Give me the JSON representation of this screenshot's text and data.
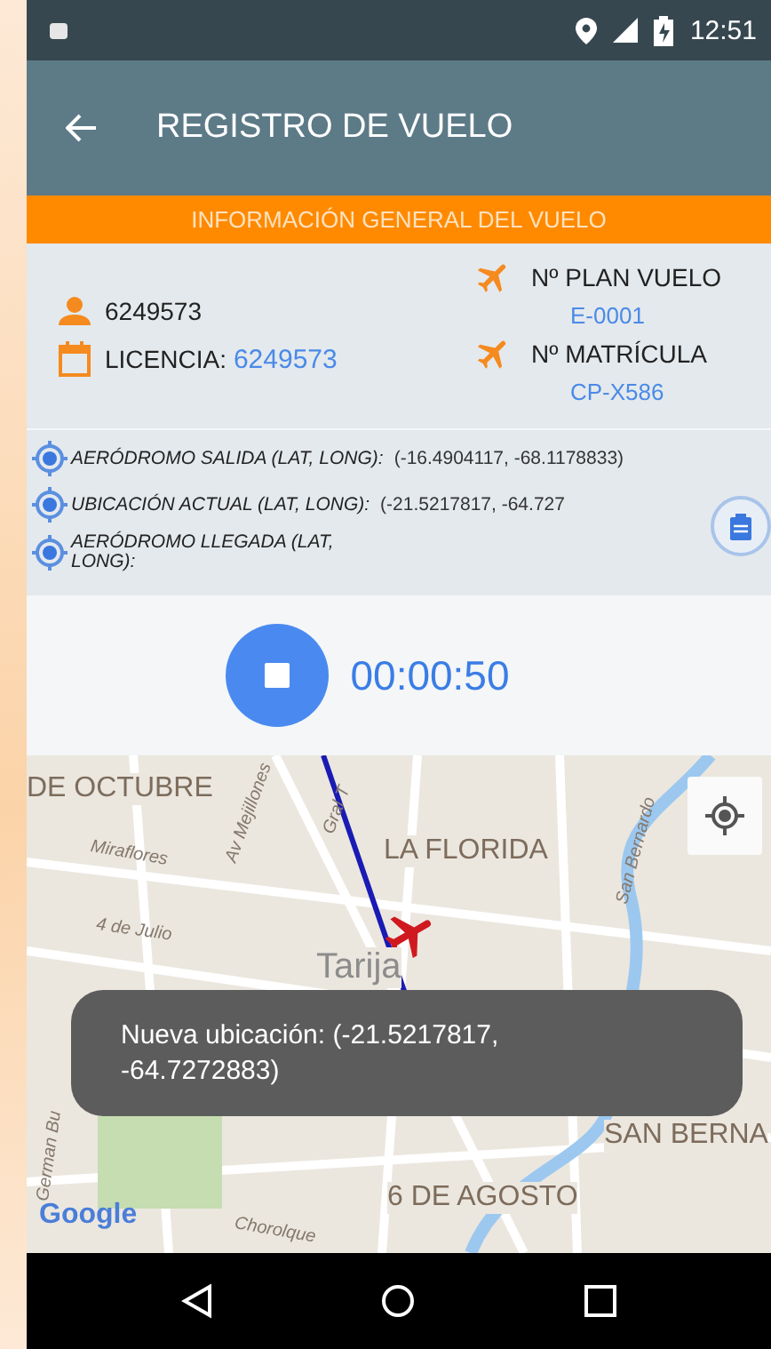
{
  "status_bar": {
    "time": "12:51"
  },
  "app_bar": {
    "title": "REGISTRO DE VUELO"
  },
  "banner": "INFORMACIÓN GENERAL DEL VUELO",
  "pilot": {
    "id": "6249573",
    "license_label": "LICENCIA:",
    "license": "6249573"
  },
  "flight": {
    "plan_label": "Nº PLAN VUELO",
    "plan": "E-0001",
    "registration_label": "Nº MATRÍCULA",
    "registration": "CP-X586"
  },
  "locations": [
    {
      "label": "AERÓDROMO SALIDA (LAT, LONG):",
      "value": "(-16.4904117, -68.1178833)"
    },
    {
      "label": "UBICACIÓN ACTUAL (LAT, LONG):",
      "value": "(-21.5217817, -64.727"
    },
    {
      "label": "AERÓDROMO LLEGADA (LAT, LONG):"
    }
  ],
  "timer": {
    "time": "00:00:50"
  },
  "map": {
    "labels": [
      {
        "text": "DE OCTUBRE",
        "kind": "district"
      },
      {
        "text": "Miraflores",
        "kind": "street"
      },
      {
        "text": "Av Mejillones",
        "kind": "street"
      },
      {
        "text": "4 de Julio",
        "kind": "street"
      },
      {
        "text": "Gral T",
        "kind": "street"
      },
      {
        "text": "LA FLORIDA",
        "kind": "district"
      },
      {
        "text": "Tarija",
        "kind": "city"
      },
      {
        "text": "San Bernardo",
        "kind": "street"
      },
      {
        "text": "German Bu",
        "kind": "street"
      },
      {
        "text": "SAN BERNA",
        "kind": "district"
      },
      {
        "text": "6 DE AGOSTO",
        "kind": "district"
      },
      {
        "text": "Chorolque",
        "kind": "street"
      }
    ],
    "attribution": "Google"
  },
  "toast": "Nueva ubicación: (-21.5217817, -64.7272883)"
}
